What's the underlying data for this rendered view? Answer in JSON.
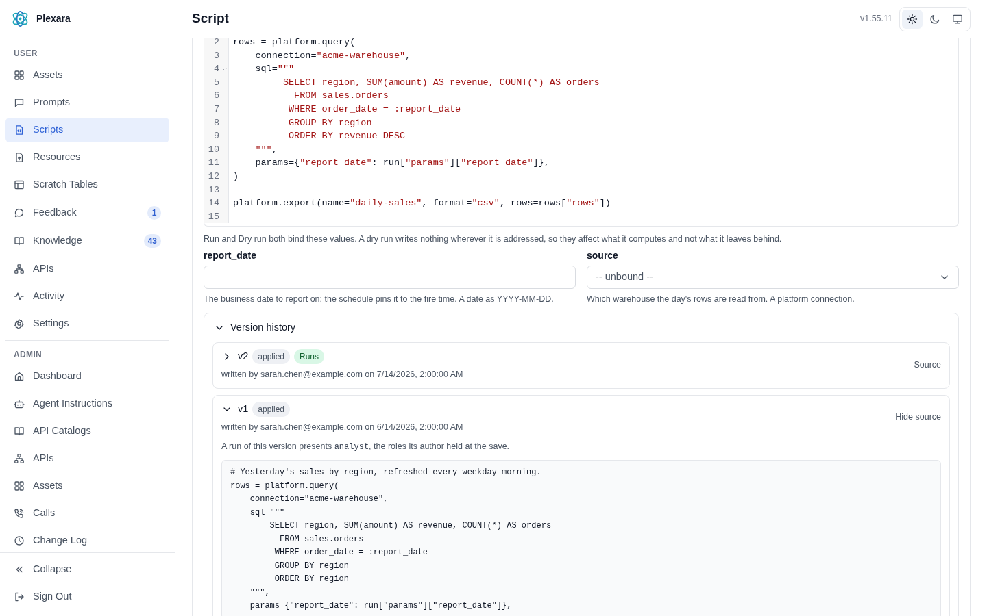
{
  "brand": {
    "name": "Plexara"
  },
  "sidebar": {
    "sections": [
      {
        "label": "USER",
        "items": [
          {
            "label": "Assets",
            "kind": "grid",
            "selected": false
          },
          {
            "label": "Prompts",
            "kind": "chat",
            "selected": false
          },
          {
            "label": "Scripts",
            "kind": "script",
            "selected": true
          },
          {
            "label": "Resources",
            "kind": "upload",
            "selected": false
          },
          {
            "label": "Scratch Tables",
            "kind": "table",
            "selected": false
          },
          {
            "label": "Feedback",
            "kind": "bubble",
            "selected": false,
            "badge": "1"
          },
          {
            "label": "Knowledge",
            "kind": "book",
            "selected": false,
            "badge": "43"
          },
          {
            "label": "APIs",
            "kind": "network",
            "selected": false
          },
          {
            "label": "Activity",
            "kind": "pulse",
            "selected": false
          },
          {
            "label": "Settings",
            "kind": "gear",
            "selected": false
          }
        ]
      },
      {
        "label": "ADMIN",
        "items": [
          {
            "label": "Dashboard",
            "kind": "home",
            "selected": false
          },
          {
            "label": "Agent Instructions",
            "kind": "robot",
            "selected": false
          },
          {
            "label": "API Catalogs",
            "kind": "book",
            "selected": false
          },
          {
            "label": "APIs",
            "kind": "network",
            "selected": false
          },
          {
            "label": "Assets",
            "kind": "grid",
            "selected": false
          },
          {
            "label": "Calls",
            "kind": "phone",
            "selected": false
          },
          {
            "label": "Change Log",
            "kind": "clock",
            "selected": false
          }
        ]
      }
    ],
    "footer": [
      {
        "label": "Collapse",
        "kind": "collapse"
      },
      {
        "label": "Sign Out",
        "kind": "signout"
      }
    ]
  },
  "header": {
    "title": "Script",
    "version": "v1.55.11",
    "theme_buttons": [
      {
        "kind": "light",
        "selected": true
      },
      {
        "kind": "dark",
        "selected": false
      },
      {
        "kind": "system",
        "selected": false
      }
    ]
  },
  "editor": {
    "lines": [
      {
        "number": "2",
        "foldable": false,
        "tokens": [
          {
            "text": "rows = platform.query(",
            "kind": "plain"
          }
        ]
      },
      {
        "number": "3",
        "foldable": false,
        "tokens": [
          {
            "text": "    connection=",
            "kind": "plain"
          },
          {
            "text": "\"acme-warehouse\"",
            "kind": "string"
          },
          {
            "text": ",",
            "kind": "plain"
          }
        ]
      },
      {
        "number": "4",
        "foldable": true,
        "tokens": [
          {
            "text": "    sql=",
            "kind": "plain"
          },
          {
            "text": "\"\"\"",
            "kind": "string"
          }
        ]
      },
      {
        "number": "5",
        "foldable": false,
        "tokens": [
          {
            "text": "         SELECT region, SUM(amount) AS revenue, COUNT(*) AS orders",
            "kind": "string"
          }
        ]
      },
      {
        "number": "6",
        "foldable": false,
        "tokens": [
          {
            "text": "           FROM sales.orders",
            "kind": "string"
          }
        ]
      },
      {
        "number": "7",
        "foldable": false,
        "tokens": [
          {
            "text": "          WHERE order_date = :report_date",
            "kind": "string"
          }
        ]
      },
      {
        "number": "8",
        "foldable": false,
        "tokens": [
          {
            "text": "          GROUP BY region",
            "kind": "string"
          }
        ]
      },
      {
        "number": "9",
        "foldable": false,
        "tokens": [
          {
            "text": "          ORDER BY revenue DESC",
            "kind": "string"
          }
        ]
      },
      {
        "number": "10",
        "foldable": false,
        "tokens": [
          {
            "text": "    \"\"\"",
            "kind": "string"
          },
          {
            "text": ",",
            "kind": "plain"
          }
        ]
      },
      {
        "number": "11",
        "foldable": false,
        "tokens": [
          {
            "text": "    params={",
            "kind": "plain"
          },
          {
            "text": "\"report_date\"",
            "kind": "string"
          },
          {
            "text": ": run[",
            "kind": "plain"
          },
          {
            "text": "\"params\"",
            "kind": "string"
          },
          {
            "text": "][",
            "kind": "plain"
          },
          {
            "text": "\"report_date\"",
            "kind": "string"
          },
          {
            "text": "]},",
            "kind": "plain"
          }
        ]
      },
      {
        "number": "12",
        "foldable": false,
        "tokens": [
          {
            "text": ")",
            "kind": "plain"
          }
        ]
      },
      {
        "number": "13",
        "foldable": false
      },
      {
        "number": "14",
        "foldable": false,
        "tokens": [
          {
            "text": "platform.export(name=",
            "kind": "plain"
          },
          {
            "text": "\"daily-sales\"",
            "kind": "string"
          },
          {
            "text": ", format=",
            "kind": "plain"
          },
          {
            "text": "\"csv\"",
            "kind": "string"
          },
          {
            "text": ", rows=rows[",
            "kind": "plain"
          },
          {
            "text": "\"rows\"",
            "kind": "string"
          },
          {
            "text": "])",
            "kind": "plain"
          }
        ]
      },
      {
        "number": "15",
        "foldable": false
      }
    ]
  },
  "params": {
    "intro": "Run and Dry run both bind these values. A dry run writes nothing wherever it is addressed, so they affect what it computes and not what it leaves behind.",
    "fields": [
      {
        "label": "report_date",
        "kind": "text",
        "hint": "The business date to report on; the schedule pins it to the fire time. A date as YYYY-MM-DD."
      },
      {
        "label": "source",
        "kind": "select",
        "value": "-- unbound --",
        "hint": "Which warehouse the day's rows are read from. A platform connection."
      }
    ]
  },
  "version_history": {
    "title": "Version history",
    "expanded": true,
    "versions": [
      {
        "name": "v2",
        "expanded": false,
        "tags": [
          {
            "text": "applied",
            "kind": "neutral"
          },
          {
            "text": "Runs",
            "kind": "success"
          }
        ],
        "meta": "written by sarah.chen@example.com on 7/14/2026, 2:00:00 AM",
        "action": "Source"
      },
      {
        "name": "v1",
        "expanded": true,
        "tags": [
          {
            "text": "applied",
            "kind": "neutral"
          }
        ],
        "meta": "written by sarah.chen@example.com on 6/14/2026, 2:00:00 AM",
        "action": "Hide source",
        "note": {
          "before": "A run of this version presents ",
          "role": "analyst",
          "after": ", the roles its author held at the save."
        },
        "source": [
          "# Yesterday's sales by region, refreshed every weekday morning.",
          "rows = platform.query(",
          "    connection=\"acme-warehouse\",",
          "    sql=\"\"\"",
          "        SELECT region, SUM(amount) AS revenue, COUNT(*) AS orders",
          "          FROM sales.orders",
          "         WHERE order_date = :report_date",
          "         GROUP BY region",
          "         ORDER BY region",
          "    \"\"\",",
          "    params={\"report_date\": run[\"params\"][\"report_date\"]},"
        ]
      }
    ]
  }
}
